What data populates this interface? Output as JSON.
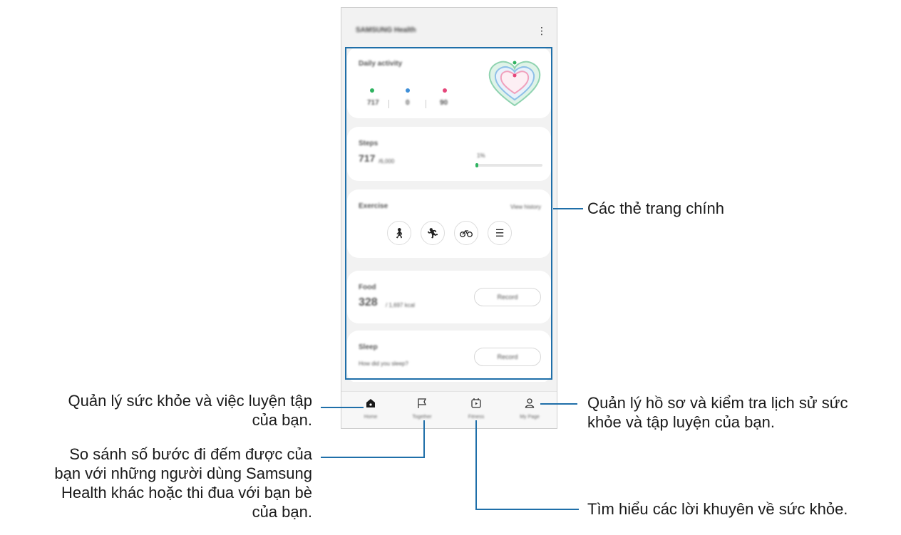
{
  "app": {
    "title": "SAMSUNG Health",
    "menu_icon": "more-vert-icon"
  },
  "cards": {
    "daily_activity": {
      "title": "Daily activity",
      "stats": [
        {
          "icon": "steps-icon",
          "value": "717",
          "color": "#2fb360"
        },
        {
          "icon": "active-time-icon",
          "value": "0",
          "color": "#3f8fd8"
        },
        {
          "icon": "calories-icon",
          "value": "90",
          "color": "#e5467a"
        }
      ]
    },
    "steps": {
      "title": "Steps",
      "value": "717",
      "goal": "/6,000",
      "percent_label": "1%",
      "progress_fraction": 0.01
    },
    "exercise": {
      "title": "Exercise",
      "link": "View history",
      "buttons": [
        "walking-icon",
        "running-icon",
        "cycling-icon",
        "list-icon"
      ]
    },
    "food": {
      "title": "Food",
      "value": "328",
      "unit": "/ 1,697 kcal",
      "button": "Record"
    },
    "sleep": {
      "title": "Sleep",
      "question": "How did you sleep?",
      "button": "Record"
    }
  },
  "nav": [
    {
      "label": "Home",
      "icon": "home-icon",
      "active": true
    },
    {
      "label": "Together",
      "icon": "flag-icon",
      "active": false
    },
    {
      "label": "Fitness",
      "icon": "fitness-video-icon",
      "active": false
    },
    {
      "label": "My Page",
      "icon": "person-icon",
      "active": false
    }
  ],
  "callouts": {
    "home_cards": "Các thẻ trang chính",
    "home_tab": [
      "Quản lý sức khỏe và việc luyện tập",
      "của bạn."
    ],
    "together_tab": [
      "So sánh số bước đi đếm được của",
      "bạn với những người dùng Samsung",
      "Health khác hoặc thi đua với bạn bè",
      "của bạn."
    ],
    "my_page_tab": [
      "Quản lý hồ sơ và kiểm tra lịch sử sức",
      "khỏe và tập luyện của bạn."
    ],
    "fitness_tab": "Tìm hiểu các lời khuyên về sức khỏe."
  },
  "colors": {
    "accent_line": "#1f6fa9",
    "steps_green": "#2fb360"
  }
}
